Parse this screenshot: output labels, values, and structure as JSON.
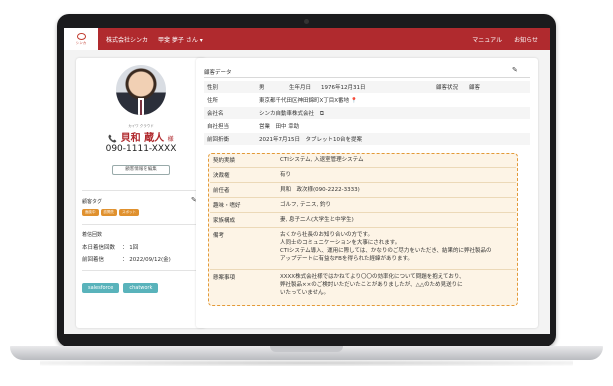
{
  "header": {
    "company": "株式会社シンカ",
    "user": "甲斐 夢子 さん ▾",
    "logo_text": "シンカ",
    "links": [
      "マニュアル",
      "お知らせ"
    ]
  },
  "profile": {
    "kana": "カイワ  クラウド",
    "name": "貝和  蔵人",
    "honorific": "様",
    "phone": "090-1111-XXXX",
    "edit_button": "顧客情報を編集"
  },
  "tags": {
    "title": "顧客タグ",
    "items": [
      "面談中",
      "訪問先",
      "スポット"
    ]
  },
  "arrivals": {
    "title": "着信回数",
    "rows": [
      {
        "label": "本日着信回数",
        "value": "： 1回"
      },
      {
        "label": "前回着信",
        "value": "： 2022/09/12(金)"
      }
    ]
  },
  "integrations": [
    "salesforce",
    "chatwork"
  ],
  "customer": {
    "title": "顧客データ",
    "gender_label": "性別",
    "gender_value": "男",
    "birth_label": "生年月日",
    "birth_value": "1976年12月31日",
    "status_label": "顧客状況",
    "status_value": "顧客",
    "address_label": "住所",
    "address_value": "東京都千代田区神田錦町X丁目X番地",
    "company_label": "会社名",
    "company_value": "シンカ自動車株式会社",
    "staff_label": "自社担当",
    "staff_value": "営業　田中 幸助",
    "prev_label": "前回折衝",
    "prev_value": "2021年7月15日　タブレット10台を提案"
  },
  "details": [
    {
      "label": "契約実績",
      "value": "CTIシステム, 入退室管理システム"
    },
    {
      "label": "決裁権",
      "value": "有り"
    },
    {
      "label": "前任者",
      "value": "貝和　政次様(090-2222-3333)"
    },
    {
      "label": "趣味・嗜好",
      "value": "ゴルフ, テニス, 釣り"
    },
    {
      "label": "家族構成",
      "value": "妻, 息子二人(大学生と中学生)"
    },
    {
      "label": "備考",
      "lines": [
        "古くから社長のお知り合いの方です。",
        "人同士のコミュニケーションを大事にされます。",
        "CTIシステム導入、運用に際しては、かなりのご尽力をいただき、結果的に弊社製品の",
        "アップデートに有益なFBを得られた経緯があります。"
      ]
    },
    {
      "label": "懸案事項",
      "lines": [
        "XXXX株式会社様ではかねてより〇〇の効率化について問題を抱えており、",
        "弊社製品××のご検討いただいたことがありましたが、△△のため見送りに",
        "いたっていません。"
      ]
    }
  ]
}
